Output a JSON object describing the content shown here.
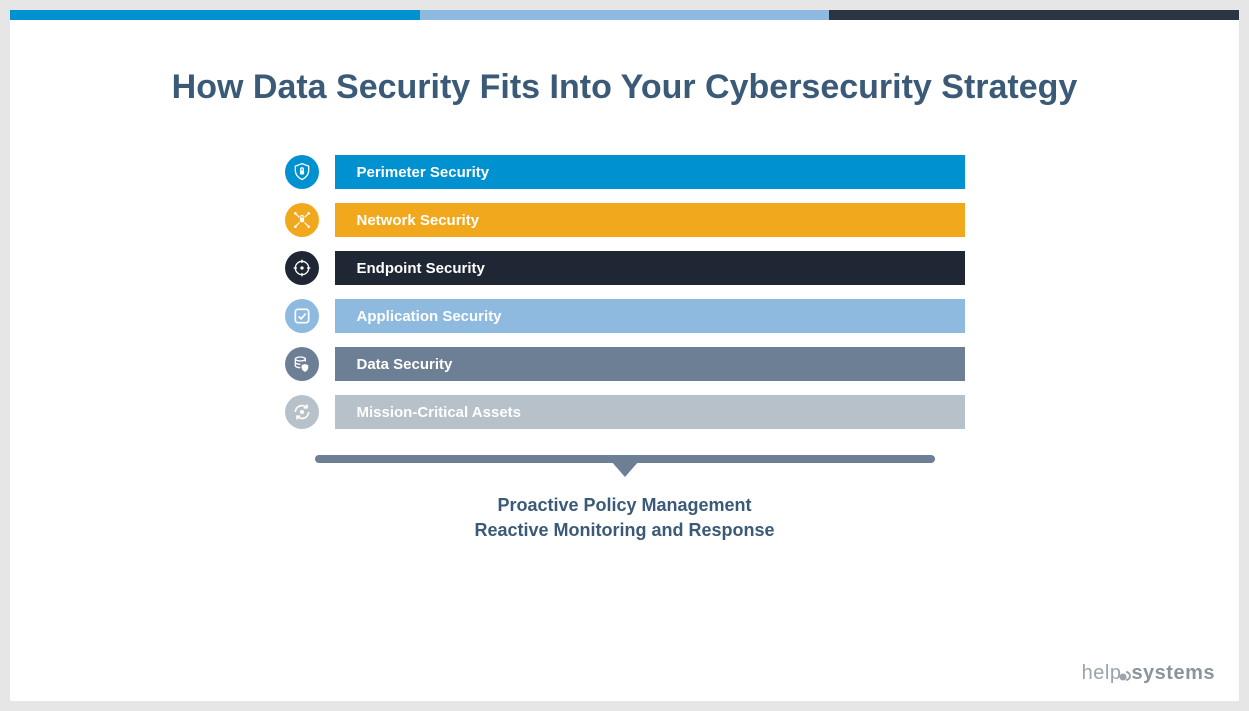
{
  "title": "How Data Security Fits Into Your Cybersecurity Strategy",
  "layers": [
    {
      "label": "Perimeter Security",
      "color": "#0091d0",
      "icon": "shield-lock"
    },
    {
      "label": "Network Security",
      "color": "#f2a81d",
      "icon": "network-lock"
    },
    {
      "label": "Endpoint Security",
      "color": "#1e2733",
      "icon": "target"
    },
    {
      "label": "Application Security",
      "color": "#8ebae0",
      "icon": "check-box"
    },
    {
      "label": "Data Security",
      "color": "#6d7f95",
      "icon": "data-shield"
    },
    {
      "label": "Mission-Critical Assets",
      "color": "#b7c1ca",
      "icon": "rotate"
    }
  ],
  "bottom": {
    "line1": "Proactive Policy Management",
    "line2": "Reactive Monitoring and Response"
  },
  "brand": {
    "part1": "help",
    "part2": "systems"
  },
  "colors": {
    "stripe1": "#0091d0",
    "stripe2": "#8ebae0",
    "stripe3": "#2b3442",
    "arrow": "#6d7f95",
    "titleText": "#3a5a78"
  }
}
